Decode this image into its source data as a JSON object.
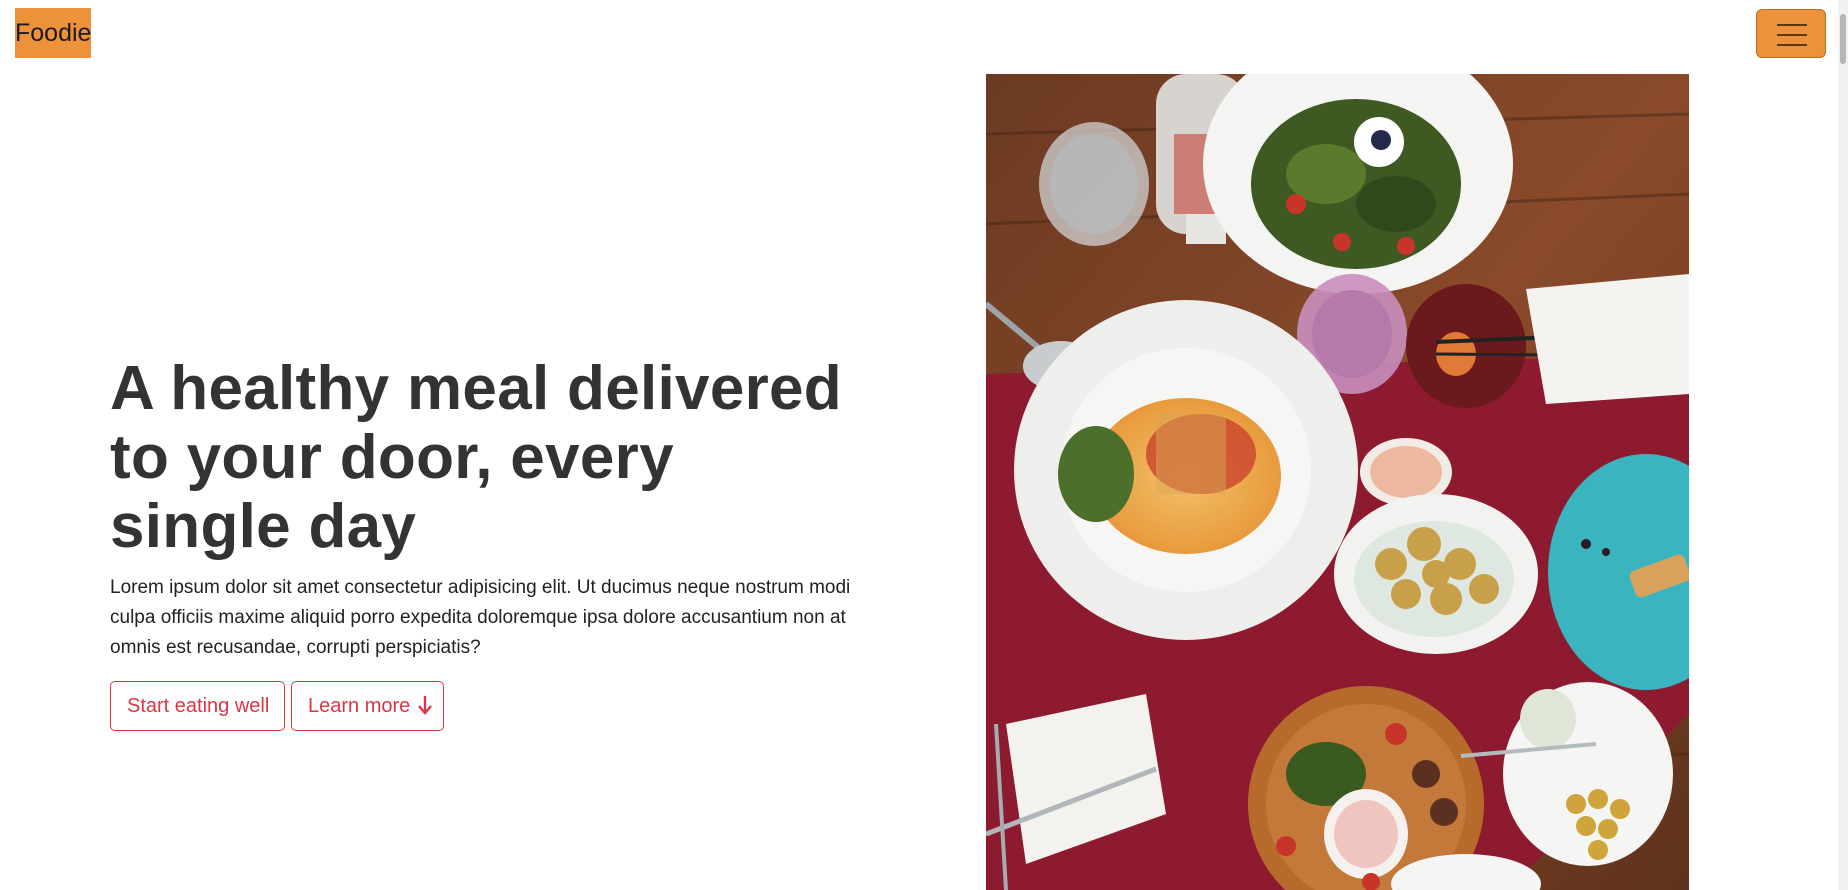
{
  "navbar": {
    "brand": "Foodie",
    "menu_icon": "hamburger-icon"
  },
  "hero": {
    "title": "A healthy meal delivered to your door, every single day",
    "description": "Lorem ipsum dolor sit amet consectetur adipisicing elit. Ut ducimus neque nostrum modi culpa officiis maxime aliquid porro expedita doloremque ipsa dolore accusantium non at omnis est recusandae, corrupti perspiciatis?",
    "primary_button": "Start eating well",
    "secondary_button": "Learn more",
    "secondary_icon": "arrow-down-icon"
  },
  "colors": {
    "brand_bg": "#ee913b",
    "button_accent": "#dc3545",
    "heading": "#333333"
  }
}
